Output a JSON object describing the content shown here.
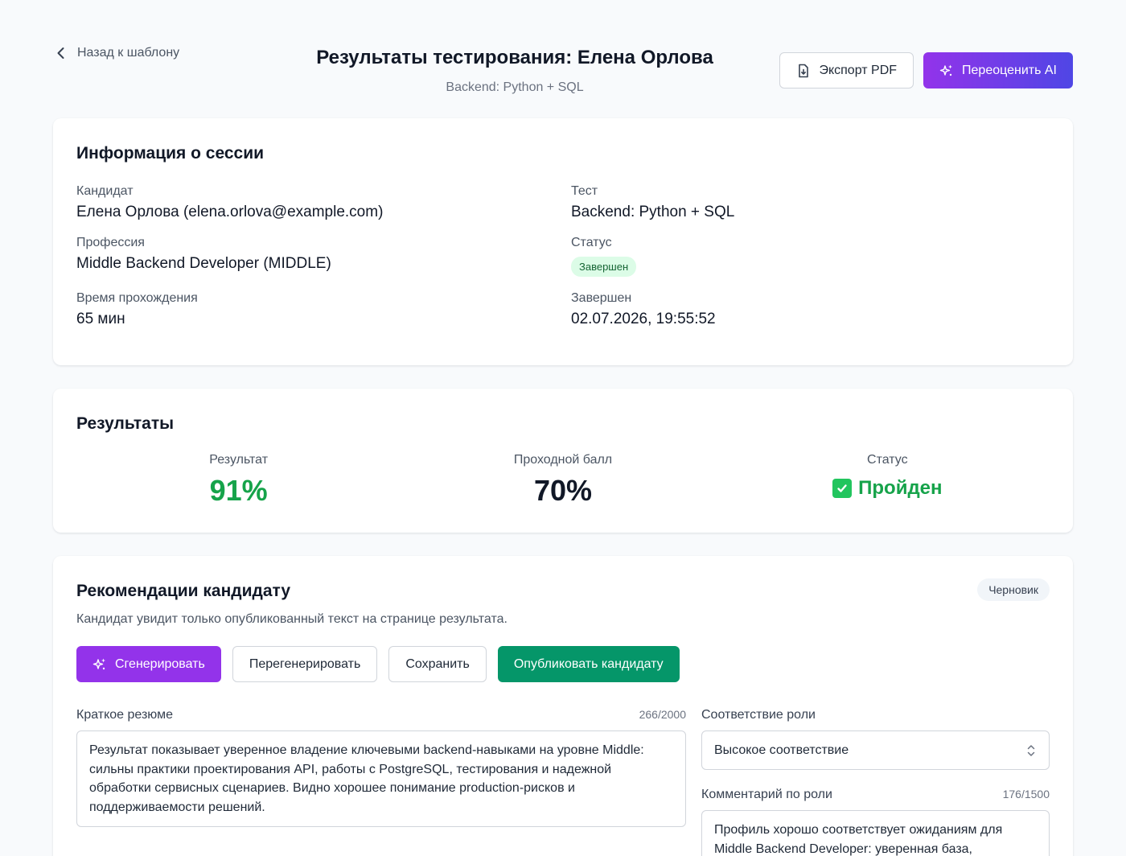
{
  "header": {
    "back_label": "Назад к шаблону",
    "title": "Результаты тестирования: Елена Орлова",
    "subtitle": "Backend: Python + SQL",
    "export_label": "Экспорт PDF",
    "reassess_label": "Переоценить AI"
  },
  "session": {
    "title": "Информация о сессии",
    "candidate_label": "Кандидат",
    "candidate_value": "Елена Орлова (elena.orlova@example.com)",
    "test_label": "Тест",
    "test_value": "Backend: Python + SQL",
    "profession_label": "Профессия",
    "profession_value": "Middle Backend Developer (MIDDLE)",
    "status_label": "Статус",
    "status_value": "Завершен",
    "duration_label": "Время прохождения",
    "duration_value": "65 мин",
    "finished_label": "Завершен",
    "finished_value": "02.07.2026, 19:55:52"
  },
  "results": {
    "title": "Результаты",
    "score_label": "Результат",
    "score_value": "91%",
    "pass_label": "Проходной балл",
    "pass_value": "70%",
    "status_label": "Статус",
    "status_value": "Пройден"
  },
  "recommendations": {
    "title": "Рекомендации кандидату",
    "badge": "Черновик",
    "description": "Кандидат увидит только опубликованный текст на странице результата.",
    "generate_label": "Сгенерировать",
    "regenerate_label": "Перегенерировать",
    "save_label": "Сохранить",
    "publish_label": "Опубликовать кандидату",
    "summary_label": "Краткое резюме",
    "summary_count": "266/2000",
    "summary_text": "Результат показывает уверенное владение ключевыми backend-навыками на уровне Middle: сильны практики проектирования API, работы с PostgreSQL, тестирования и надежной обработки сервисных сценариев. Видно хорошее понимание production-рисков и поддерживаемости решений.",
    "role_match_label": "Соответствие роли",
    "role_match_value": "Высокое соответствие",
    "role_comment_label": "Комментарий по роли",
    "role_comment_count": "176/1500",
    "role_comment_text": "Профиль хорошо соответствует ожиданиям для Middle Backend Developer: уверенная база,"
  },
  "colors": {
    "accent_purple": "#9333ea",
    "accent_green": "#059669",
    "success": "#16a34a"
  }
}
